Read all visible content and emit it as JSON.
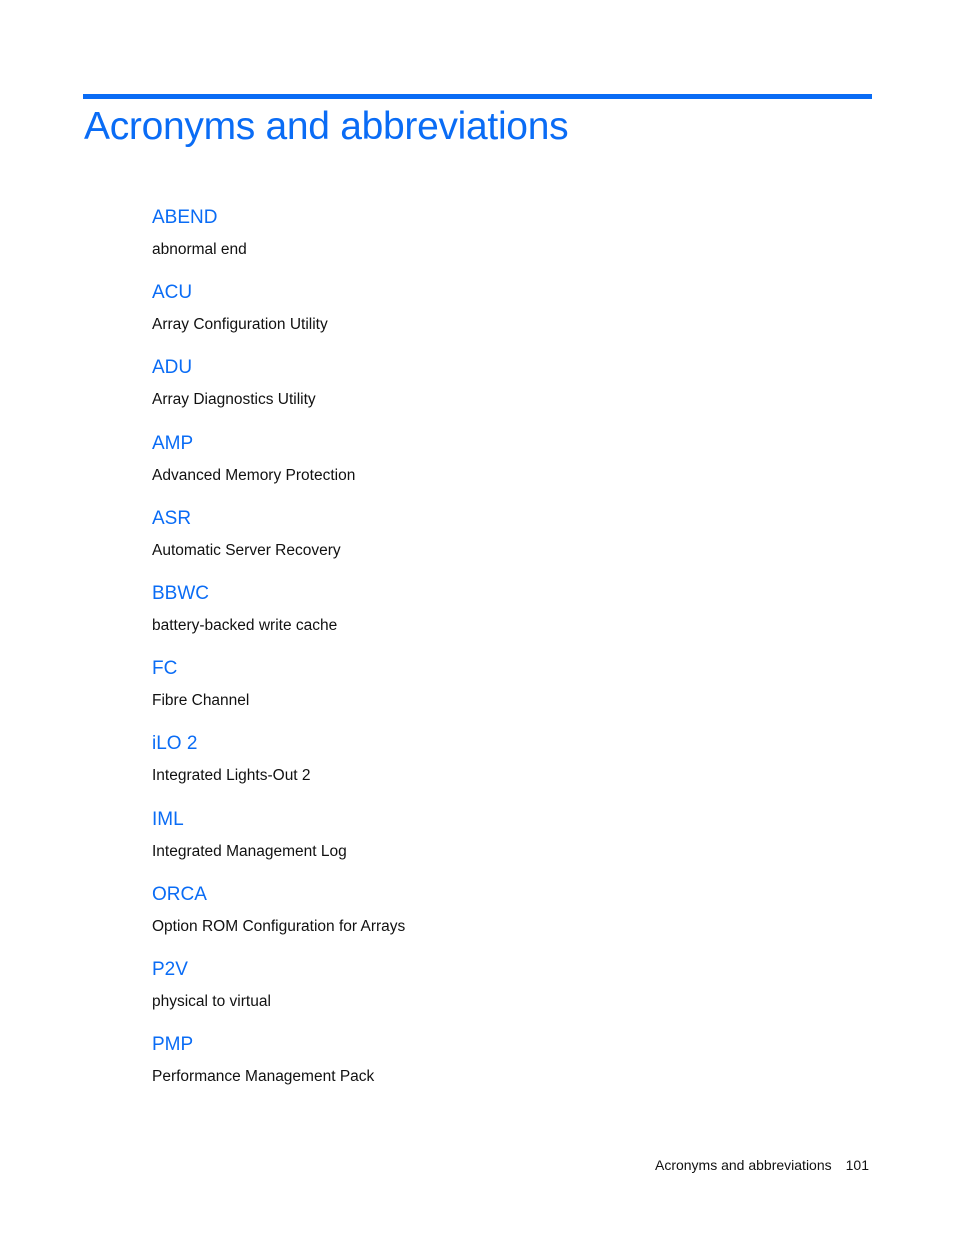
{
  "page": {
    "title": "Acronyms and abbreviations",
    "accent_color": "#0a6cf5"
  },
  "entries": [
    {
      "term": "ABEND",
      "definition": "abnormal end"
    },
    {
      "term": "ACU",
      "definition": "Array Configuration Utility"
    },
    {
      "term": "ADU",
      "definition": "Array Diagnostics Utility"
    },
    {
      "term": "AMP",
      "definition": "Advanced Memory Protection"
    },
    {
      "term": "ASR",
      "definition": "Automatic Server Recovery"
    },
    {
      "term": "BBWC",
      "definition": "battery-backed write cache"
    },
    {
      "term": "FC",
      "definition": "Fibre Channel"
    },
    {
      "term": "iLO 2",
      "definition": "Integrated Lights-Out 2"
    },
    {
      "term": "IML",
      "definition": "Integrated Management Log"
    },
    {
      "term": "ORCA",
      "definition": "Option ROM Configuration for Arrays"
    },
    {
      "term": "P2V",
      "definition": "physical to virtual"
    },
    {
      "term": "PMP",
      "definition": "Performance Management Pack"
    }
  ],
  "footer": {
    "section": "Acronyms and abbreviations",
    "page_number": "101"
  }
}
